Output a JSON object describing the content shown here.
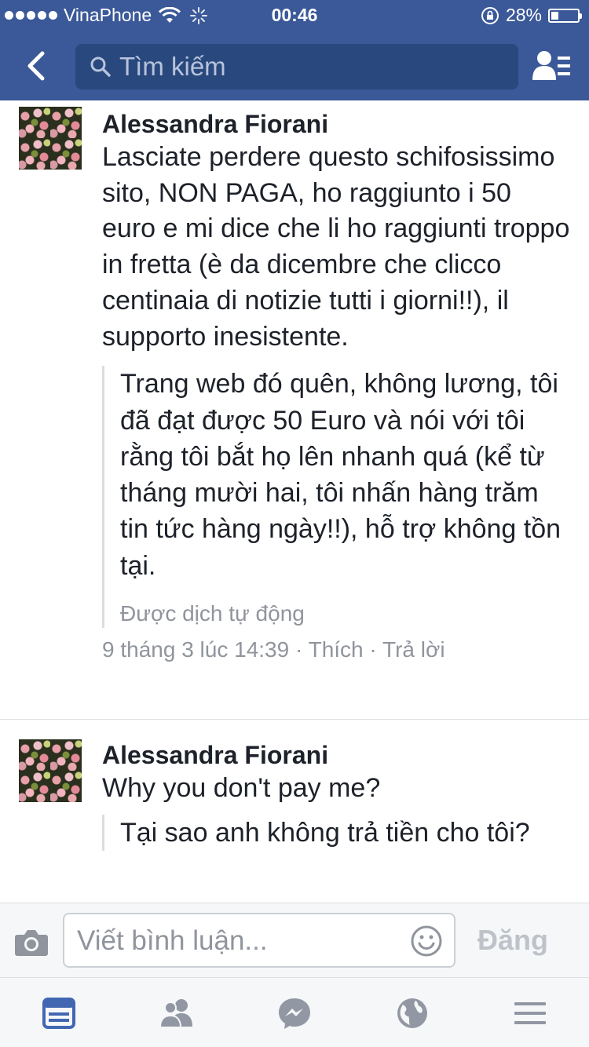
{
  "status_bar": {
    "carrier": "VinaPhone",
    "time": "00:46",
    "battery_percent": "28%",
    "battery_level": 0.28
  },
  "nav": {
    "search_placeholder": "Tìm kiếm",
    "icons": [
      "back-icon",
      "search-icon",
      "friends-list-icon"
    ]
  },
  "comments": [
    {
      "author": "Alessandra Fiorani",
      "text": "Lasciate perdere questo schifosissimo sito, NON PAGA, ho raggiunto i 50 euro e mi dice che li ho raggiunti troppo in fretta (è da dicembre che clicco centinaia di notizie tutti i giorni!!), il supporto inesistente.",
      "translation": "Trang web đó quên, không lương, tôi đã đạt được 50 Euro và nói với tôi rằng tôi bắt họ lên nhanh quá (kể từ tháng mười hai, tôi nhấn hàng trăm tin tức hàng ngày!!), hỗ trợ không tồn tại.",
      "translated_label": "Được dịch tự động",
      "timestamp": "9 tháng 3 lúc 14:39",
      "like_label": "Thích",
      "reply_label": "Trả lời"
    },
    {
      "author": "Alessandra Fiorani",
      "text": "Why you don't pay me?",
      "translation": "Tại sao anh không trả tiền cho tôi?"
    }
  ],
  "composer": {
    "placeholder": "Viết bình luận...",
    "post_label": "Đăng",
    "icons": [
      "camera-icon",
      "emoji-icon"
    ]
  },
  "tab_bar": {
    "tabs": [
      "news-feed-icon",
      "friends-icon",
      "messenger-icon",
      "globe-icon",
      "menu-icon"
    ],
    "active_color": "#4267b2",
    "inactive_color": "#9197a3"
  },
  "colors": {
    "brand": "#3b5998",
    "search_bg": "#29487d"
  }
}
